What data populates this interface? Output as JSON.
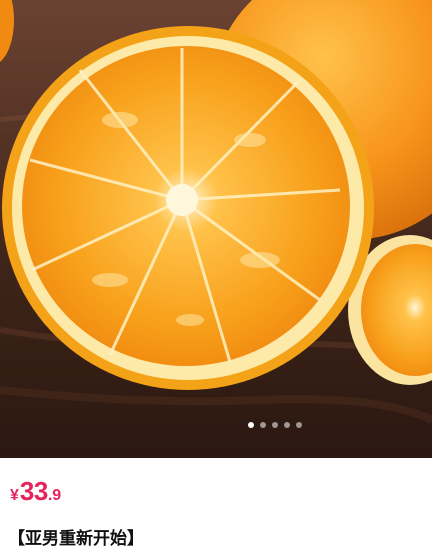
{
  "product": {
    "image_alt": "orange",
    "carousel": {
      "total": 5,
      "active_index": 0
    },
    "price": {
      "currency": "¥",
      "integer": "33",
      "decimal": ".9"
    },
    "title": "【亚男重新开始】",
    "colors": {
      "price": "#e4235e",
      "orange": "#f7a21b",
      "title": "#111111"
    }
  }
}
